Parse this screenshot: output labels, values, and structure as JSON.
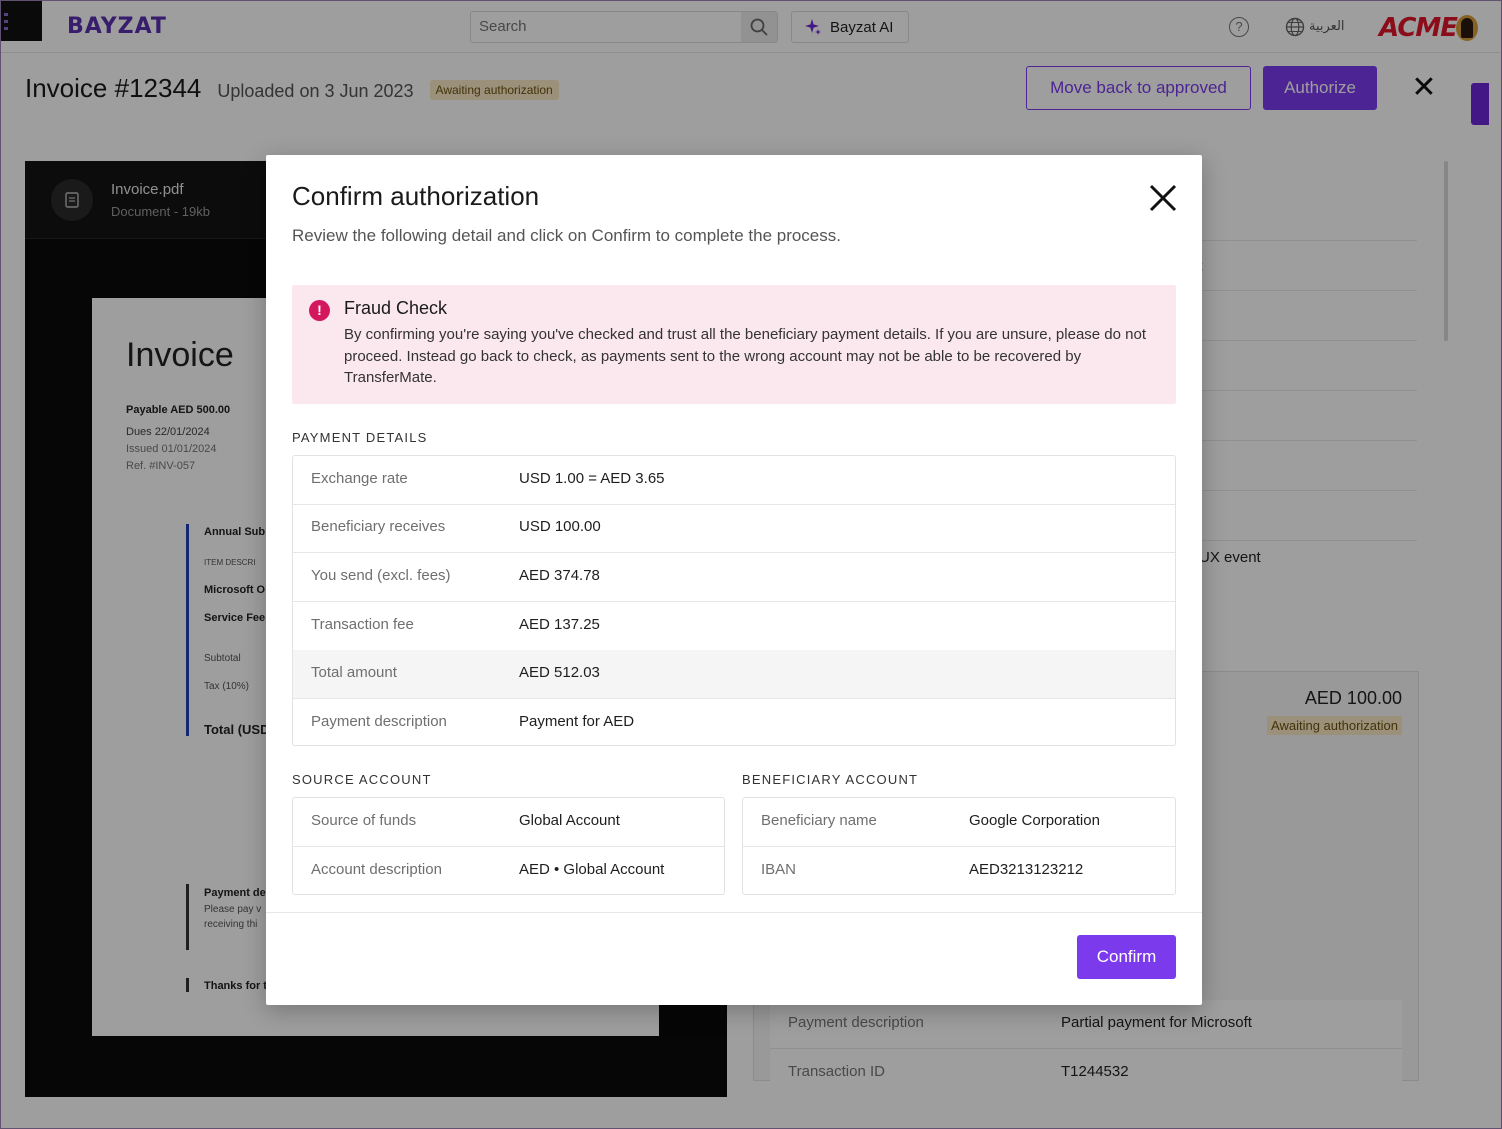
{
  "topbar": {
    "logo": "BAYZAT",
    "search_placeholder": "Search",
    "ai_label": "Bayzat AI",
    "lang_label": "العربية",
    "company_logo": "ACME",
    "icons": [
      "menu-icon",
      "search-icon",
      "sparkle-icon",
      "help-icon",
      "globe-icon",
      "avatar"
    ]
  },
  "header": {
    "title": "Invoice #12344",
    "uploaded": "Uploaded on 3 Jun 2023",
    "status": "Awaiting authorization",
    "move_back_label": "Move back to approved",
    "authorize_label": "Authorize"
  },
  "pdf": {
    "file_name": "Invoice.pdf",
    "file_meta": "Document - 19kb",
    "sheet_title": "Invoice",
    "payable": "Payable AED 500.00",
    "dues": "Dues 22/01/2024",
    "issued": "Issued 01/01/2024",
    "ref": "Ref. #INV-057",
    "item_heading": "Annual Sub",
    "item_desc_label": "ITEM DESCRI",
    "item_1": "Microsoft O",
    "item_2": "Service Fee",
    "subtotal": "Subtotal",
    "tax": "Tax (10%)",
    "total": "Total (USD",
    "payment_heading": "Payment de",
    "payment_line_1": "Please pay v",
    "payment_line_2": "receiving thi",
    "thanks": "Thanks for t"
  },
  "right_panel": {
    "partial_1": "t",
    "partial_2": "UX event",
    "amount": "AED 100.00",
    "status": "Awaiting authorization",
    "rows": [
      {
        "label": "Payment description",
        "value": "Partial payment for Microsoft"
      },
      {
        "label": "Transaction ID",
        "value": "T1244532"
      }
    ]
  },
  "modal": {
    "title": "Confirm authorization",
    "subtitle": "Review the following detail and click on Confirm to complete the process.",
    "fraud": {
      "title": "Fraud Check",
      "text": "By confirming you're saying you've checked and trust all the beneficiary payment details. If you are unsure, please do not proceed. Instead go back to check, as payments sent to the wrong account may not be able to be recovered by TransferMate."
    },
    "payment_details": {
      "heading": "PAYMENT DETAILS",
      "rows": [
        {
          "label": "Exchange rate",
          "value": "USD 1.00 = AED 3.65"
        },
        {
          "label": "Beneficiary receives",
          "value": "USD 100.00"
        },
        {
          "label": "You send (excl. fees)",
          "value": "AED 374.78"
        },
        {
          "label": "Transaction fee",
          "value": "AED 137.25"
        },
        {
          "label": "Total amount",
          "value": "AED 512.03"
        },
        {
          "label": "Payment description",
          "value": "Payment for AED"
        }
      ]
    },
    "source_account": {
      "heading": "SOURCE ACCOUNT",
      "rows": [
        {
          "label": "Source of funds",
          "value": "Global Account"
        },
        {
          "label": "Account description",
          "value": "AED • Global Account"
        }
      ]
    },
    "beneficiary_account": {
      "heading": "BENEFICIARY ACCOUNT",
      "rows": [
        {
          "label": "Beneficiary name",
          "value": "Google Corporation"
        },
        {
          "label": "IBAN",
          "value": "AED3213123212"
        }
      ]
    },
    "confirm_label": "Confirm"
  },
  "colors": {
    "accent": "#7c3aed",
    "fraud_bg": "#fbe8ef",
    "fraud_icon": "#d4175c",
    "badge_bg": "#fbe9c4",
    "acme": "#e0162b"
  }
}
